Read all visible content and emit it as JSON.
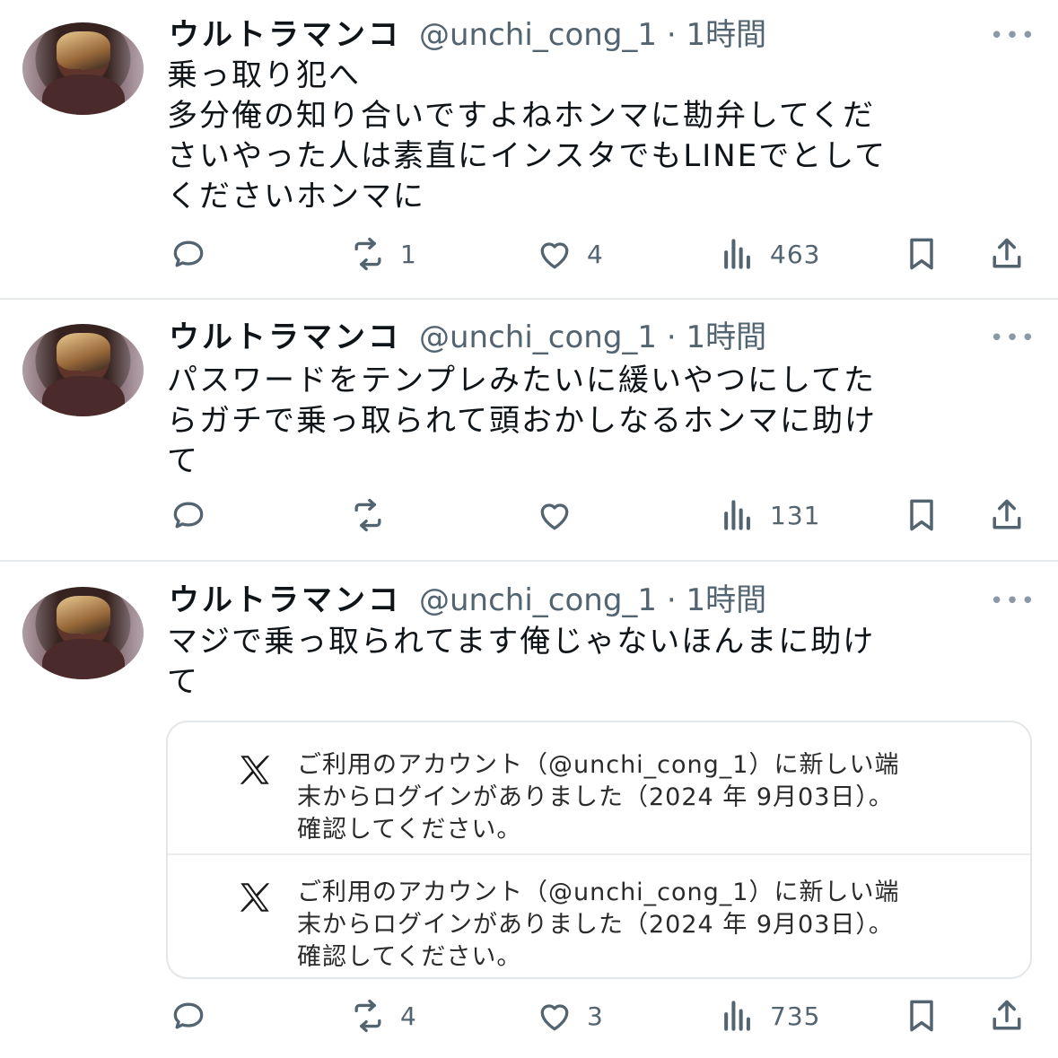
{
  "tweets": [
    {
      "name": "ウルトラマンコ",
      "handle": "@unchi_cong_1 · 1時間",
      "text": "乗っ取り犯へ\n多分俺の知り合いですよねホンマに勘弁してください やった人は素直にインスタでもLINEでとしてくださいホンマに",
      "lines": [
        "乗っ取り犯へ",
        "多分俺の知り合いですよねホンマに勘弁してくだ",
        "さいやった人は素直にインスタでもLINEでとして",
        "くださいホンマに"
      ],
      "reposts": "1",
      "likes": "4",
      "views": "463"
    },
    {
      "name": "ウルトラマンコ",
      "handle": "@unchi_cong_1 · 1時間",
      "lines": [
        "パスワードをテンプレみたいに緩いやつにしてた",
        "らガチで乗っ取られて頭おかしなるホンマに助け",
        "て"
      ],
      "reposts": "",
      "likes": "",
      "views": "131"
    },
    {
      "name": "ウルトラマンコ",
      "handle": "@unchi_cong_1 · 1時間",
      "lines": [
        "マジで乗っ取られてます俺じゃないほんまに助け",
        "て"
      ],
      "reposts": "4",
      "likes": "3",
      "views": "735",
      "card": {
        "notices": [
          {
            "lines": [
              "ご利用のアカウント（@unchi_cong_1）に新しい端",
              "末からログインがありました（2024 年 9月03日）。",
              "確認してください。"
            ]
          },
          {
            "lines": [
              "ご利用のアカウント（@unchi_cong_1）に新しい端",
              "末からログインがありました（2024 年 9月03日）。",
              "確認してください。"
            ]
          }
        ]
      }
    }
  ],
  "more_label": "•••",
  "colors": {
    "text": "#0f1419",
    "muted": "#536471",
    "divider": "#e6e9ec"
  },
  "icons": [
    "reply-icon",
    "repost-icon",
    "like-icon",
    "views-icon",
    "bookmark-icon",
    "share-icon",
    "x-logo-icon"
  ]
}
